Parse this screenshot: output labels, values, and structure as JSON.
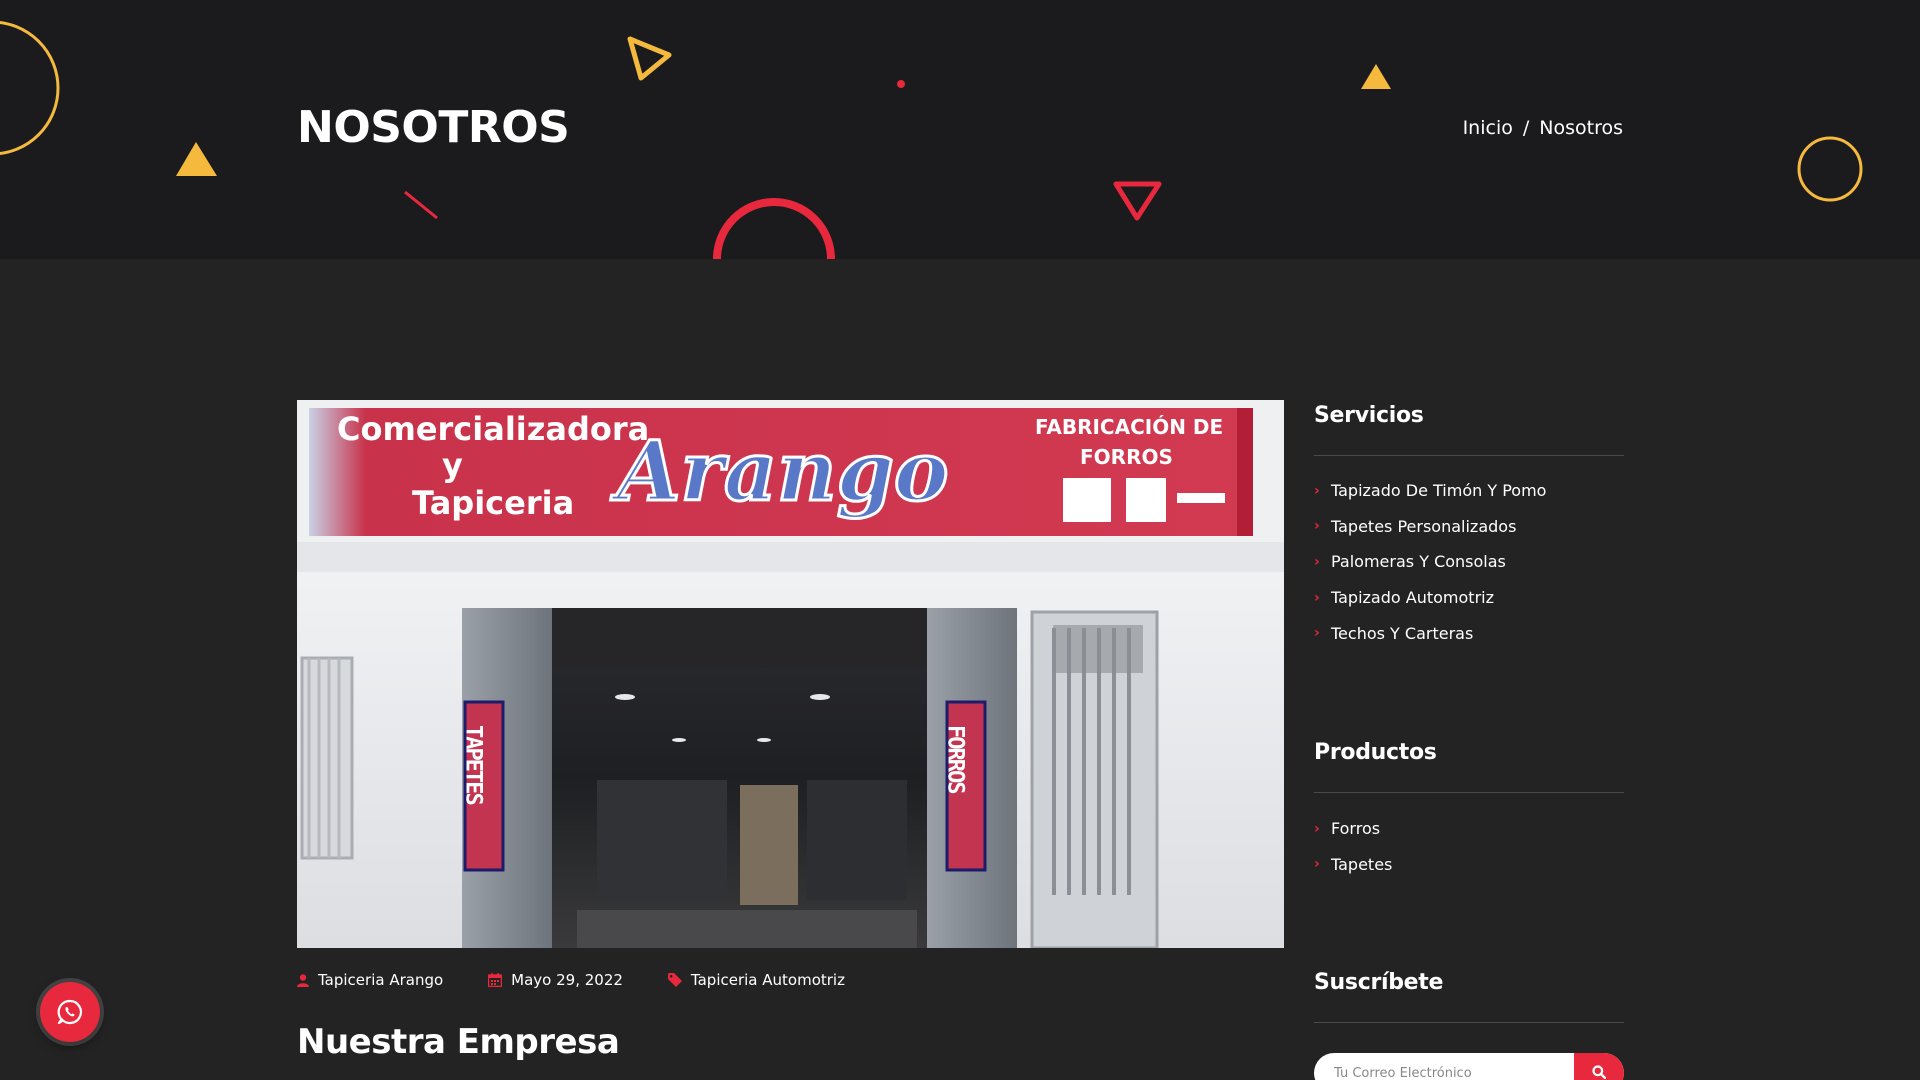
{
  "banner": {
    "title": "NOSOTROS",
    "breadcrumb": {
      "home": "Inicio",
      "separator": "/",
      "current": "Nosotros"
    }
  },
  "hero_image": {
    "sign_left": "Comercializadora",
    "sign_left2": "y",
    "sign_left3": "Tapiceria",
    "sign_brand": "Arango",
    "sign_right1": "FABRICACIÓN DE",
    "sign_right2": "FORROS",
    "banner_left": "TAPETES",
    "banner_right": "FORROS"
  },
  "meta": {
    "author": "Tapiceria Arango",
    "date": "Mayo 29, 2022",
    "category": "Tapiceria Automotriz"
  },
  "article": {
    "title": "Nuestra Empresa"
  },
  "sidebar": {
    "servicios": {
      "title": "Servicios",
      "items": [
        {
          "label": "Tapizado De Timón Y Pomo"
        },
        {
          "label": "Tapetes Personalizados"
        },
        {
          "label": "Palomeras Y Consolas"
        },
        {
          "label": "Tapizado Automotriz"
        },
        {
          "label": "Techos Y Carteras"
        }
      ]
    },
    "productos": {
      "title": "Productos",
      "items": [
        {
          "label": "Forros"
        },
        {
          "label": "Tapetes"
        }
      ]
    },
    "suscribete": {
      "title": "Suscríbete",
      "placeholder": "Tu Correo Electrónico"
    }
  },
  "colors": {
    "accent": "#e8283d",
    "gold": "#f5b93e",
    "banner_bg": "#1b1b1e",
    "page_bg": "#232323"
  },
  "icons": {
    "author": "user-icon",
    "date": "calendar-icon",
    "category": "tag-icon",
    "search": "search-icon",
    "whatsapp": "whatsapp-icon"
  }
}
